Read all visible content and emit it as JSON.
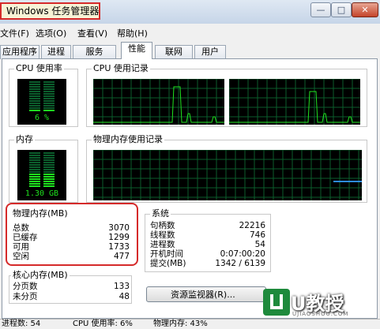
{
  "window": {
    "title": "Windows 任务管理器",
    "buttons": {
      "minimize": "—",
      "maximize": "□",
      "close": "✕"
    }
  },
  "menu": [
    "文件(F)",
    "选项(O)",
    "查看(V)",
    "帮助(H)"
  ],
  "tabs": [
    {
      "label": "应用程序"
    },
    {
      "label": "进程"
    },
    {
      "label": "服务"
    },
    {
      "label": "性能",
      "active": true
    },
    {
      "label": "联网"
    },
    {
      "label": "用户"
    }
  ],
  "cpu_usage": {
    "label": "CPU 使用率",
    "value": "6 %",
    "level": 0.06
  },
  "cpu_history": {
    "label": "CPU 使用记录"
  },
  "memory": {
    "label": "内存",
    "value": "1.30 GB",
    "level": 0.42
  },
  "memory_history": {
    "label": "物理内存使用记录"
  },
  "physical_memory": {
    "label": "物理内存(MB)",
    "rows": [
      {
        "key": "总数",
        "value": "3070"
      },
      {
        "key": "已缓存",
        "value": "1299"
      },
      {
        "key": "可用",
        "value": "1733"
      },
      {
        "key": "空闲",
        "value": "477"
      }
    ]
  },
  "kernel_memory": {
    "label": "核心内存(MB)",
    "rows": [
      {
        "key": "分页数",
        "value": "133"
      },
      {
        "key": "未分页",
        "value": "48"
      }
    ]
  },
  "system": {
    "label": "系统",
    "rows": [
      {
        "key": "句柄数",
        "value": "22216"
      },
      {
        "key": "线程数",
        "value": "746"
      },
      {
        "key": "进程数",
        "value": "54"
      },
      {
        "key": "开机时间",
        "value": "0:07:00:20"
      },
      {
        "key": "提交(MB)",
        "value": "1342 / 6139"
      }
    ]
  },
  "resource_monitor_button": "资源监视器(R)...",
  "status_bar": {
    "processes": "进程数: 54",
    "cpu": "CPU 使用率: 6%",
    "memory": "物理内存: 43%"
  },
  "watermark": {
    "brand": "U教授",
    "url": "UJIAOSHOU.COM"
  },
  "colors": {
    "graph_green": "#1fe31f",
    "grid_green": "#0b5d2c",
    "highlight_red": "#d52a2a"
  }
}
